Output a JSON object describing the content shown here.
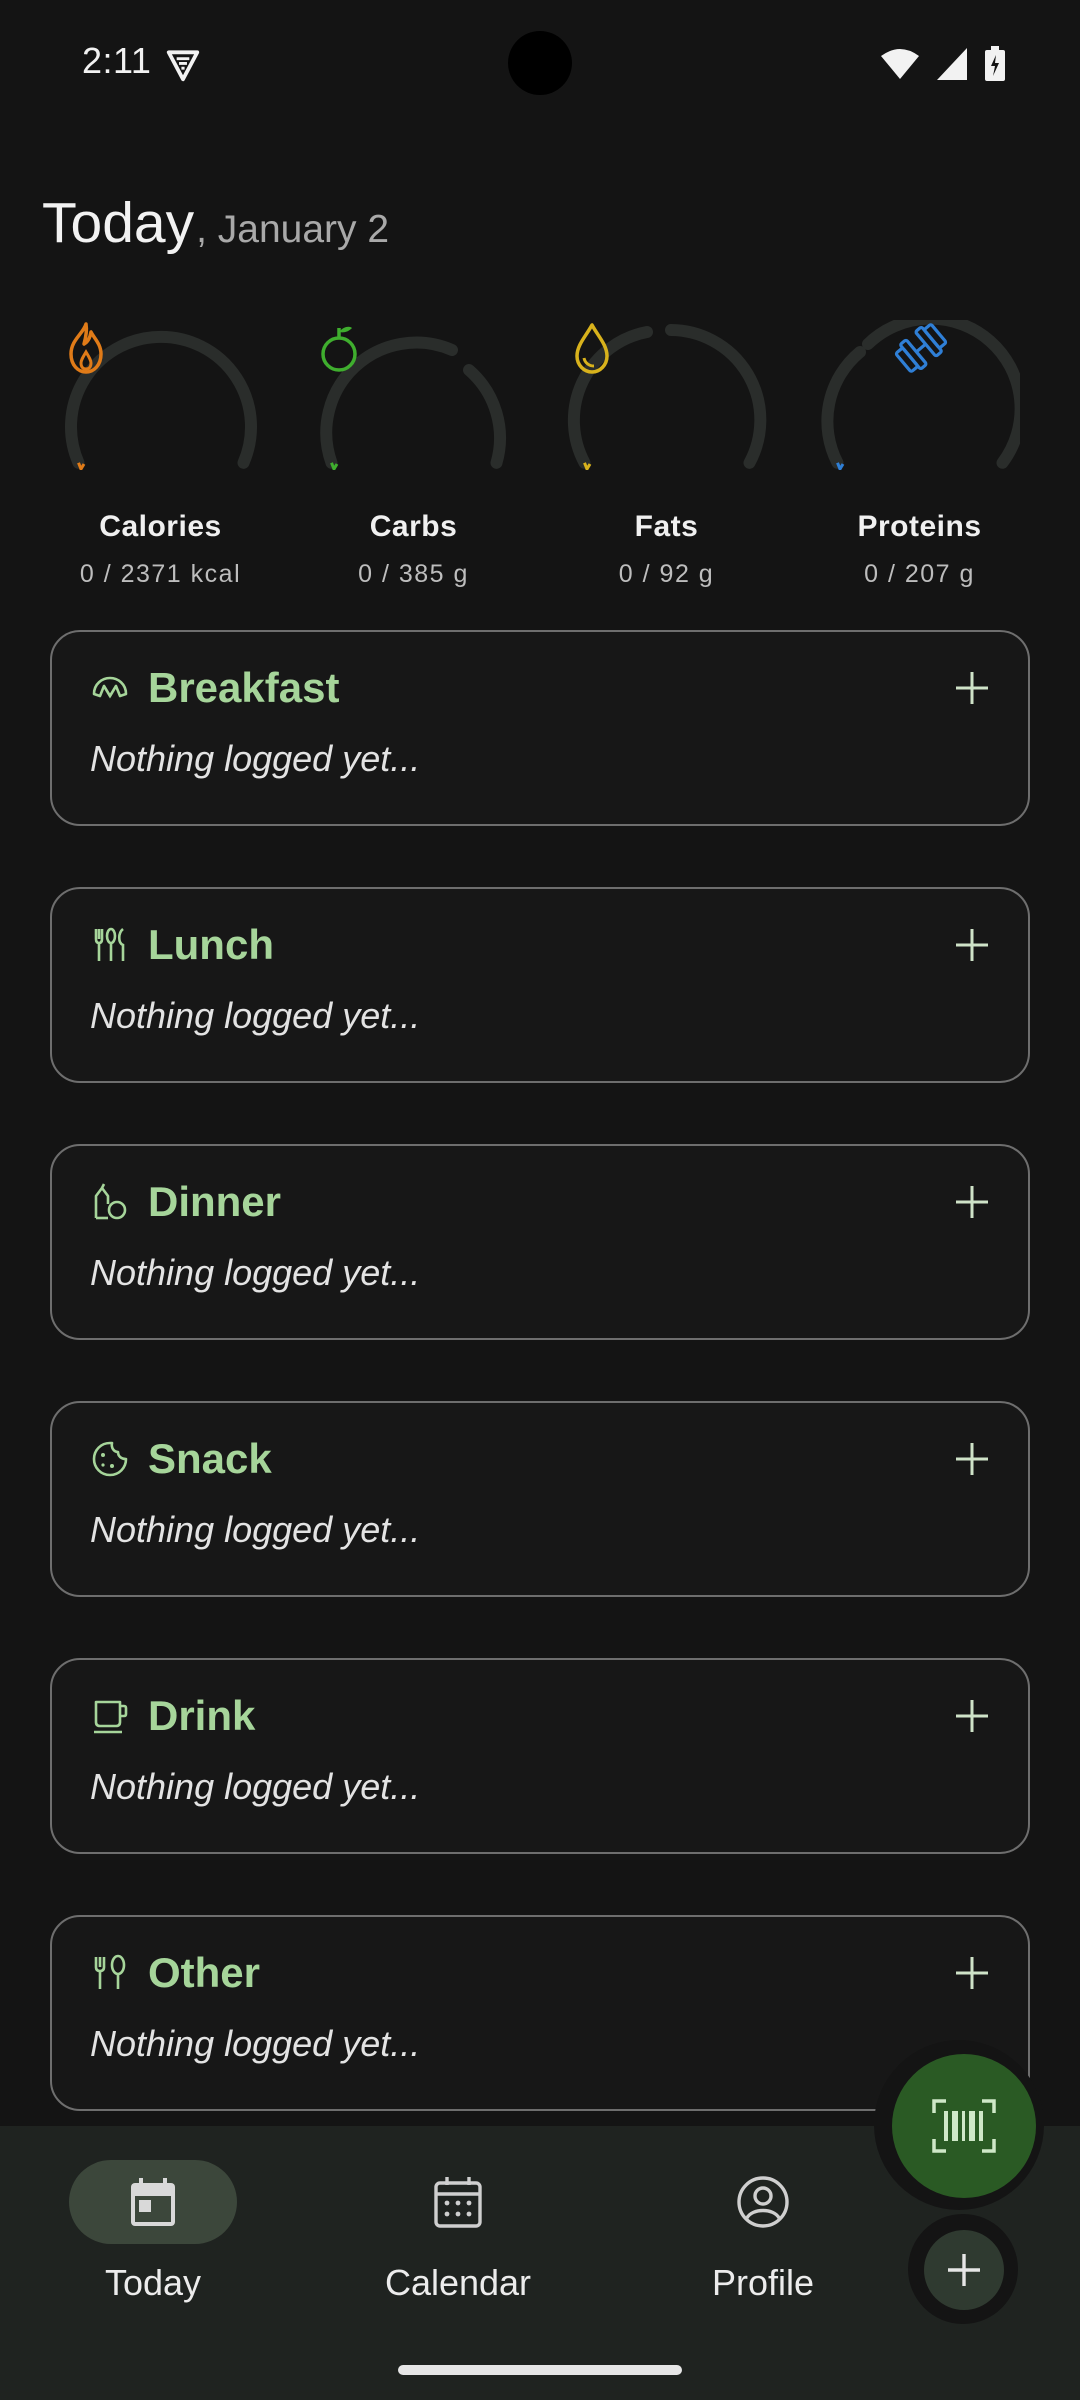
{
  "status_bar": {
    "time": "2:11"
  },
  "header": {
    "title": "Today",
    "subtitle": ", January 2"
  },
  "macros": [
    {
      "name": "Calories",
      "value": "0 / 2371 kcal",
      "icon": "flame-icon",
      "color": "#e07b18",
      "progress": 0
    },
    {
      "name": "Carbs",
      "value": "0 / 385 g",
      "icon": "apple-icon",
      "color": "#3fae2e",
      "progress": 0
    },
    {
      "name": "Fats",
      "value": "0 / 92 g",
      "icon": "drop-icon",
      "color": "#d8b21c",
      "progress": 0
    },
    {
      "name": "Proteins",
      "value": "0 / 207 g",
      "icon": "dumbbell-icon",
      "color": "#2f7fd6",
      "progress": 0
    }
  ],
  "meals": [
    {
      "title": "Breakfast",
      "empty_text": "Nothing logged yet...",
      "icon": "croissant-icon"
    },
    {
      "title": "Lunch",
      "empty_text": "Nothing logged yet...",
      "icon": "utensils-icon"
    },
    {
      "title": "Dinner",
      "empty_text": "Nothing logged yet...",
      "icon": "dinner-icon"
    },
    {
      "title": "Snack",
      "empty_text": "Nothing logged yet...",
      "icon": "cookie-icon"
    },
    {
      "title": "Drink",
      "empty_text": "Nothing logged yet...",
      "icon": "cup-icon"
    },
    {
      "title": "Other",
      "empty_text": "Nothing logged yet...",
      "icon": "fork-spoon-icon"
    }
  ],
  "nav": {
    "items": [
      {
        "label": "Today",
        "icon": "calendar-today-icon",
        "active": true
      },
      {
        "label": "Calendar",
        "icon": "calendar-icon",
        "active": false
      },
      {
        "label": "Profile",
        "icon": "profile-icon",
        "active": false
      }
    ]
  },
  "fab": {
    "scan_icon": "barcode-scan-icon",
    "add_icon": "plus-icon"
  },
  "colors": {
    "accent": "#a6d59a",
    "fab": "#2a5a24",
    "nav_bg": "#1f2320",
    "background": "#141414"
  }
}
